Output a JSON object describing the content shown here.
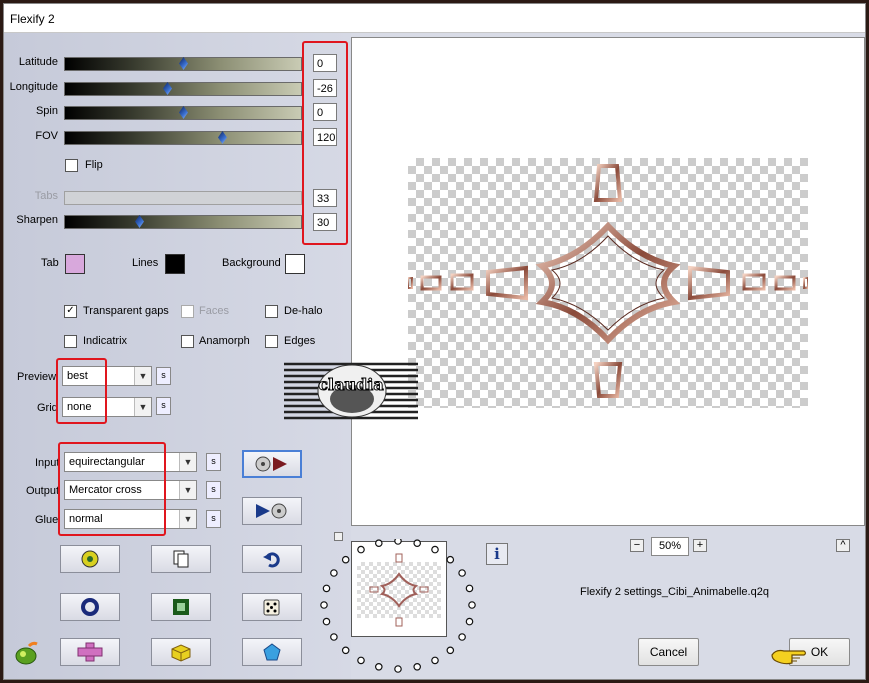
{
  "window": {
    "title": "Flexify 2"
  },
  "sliders": [
    {
      "label": "Latitude",
      "value": "0",
      "fraction": 0.5
    },
    {
      "label": "Longitude",
      "value": "-26",
      "fraction": 0.43
    },
    {
      "label": "Spin",
      "value": "0",
      "fraction": 0.5
    },
    {
      "label": "FOV",
      "value": "120",
      "fraction": 0.66
    },
    {
      "label": "Tabs",
      "value": "33",
      "fraction": 0.0
    },
    {
      "label": "Sharpen",
      "value": "30",
      "fraction": 0.3
    }
  ],
  "flip_label": "Flip",
  "colors": {
    "tab_label": "Tab",
    "tab_color": "#d8a8dc",
    "lines_label": "Lines",
    "lines_color": "#000000",
    "background_label": "Background",
    "background_color": "#ffffff"
  },
  "options": {
    "transparent_gaps": "Transparent gaps",
    "faces": "Faces",
    "dehalo": "De-halo",
    "indicatrix": "Indicatrix",
    "anamorph": "Anamorph",
    "edges": "Edges"
  },
  "preview_select": {
    "label": "Preview",
    "value": "best"
  },
  "grid_select": {
    "label": "Grid",
    "value": "none"
  },
  "input_select": {
    "label": "Input",
    "value": "equirectangular"
  },
  "output_select": {
    "label": "Output",
    "value": "Mercator cross"
  },
  "glue_select": {
    "label": "Glue",
    "value": "normal"
  },
  "s_label": "s",
  "watermark_text": "claudia",
  "zoom": {
    "minus": "−",
    "value": "50%",
    "plus": "+"
  },
  "up_label": "^",
  "info_label": "i",
  "settings_name": "Flexify 2 settings_Cibi_Animabelle.q2q",
  "cancel_label": "Cancel",
  "ok_label": "OK"
}
